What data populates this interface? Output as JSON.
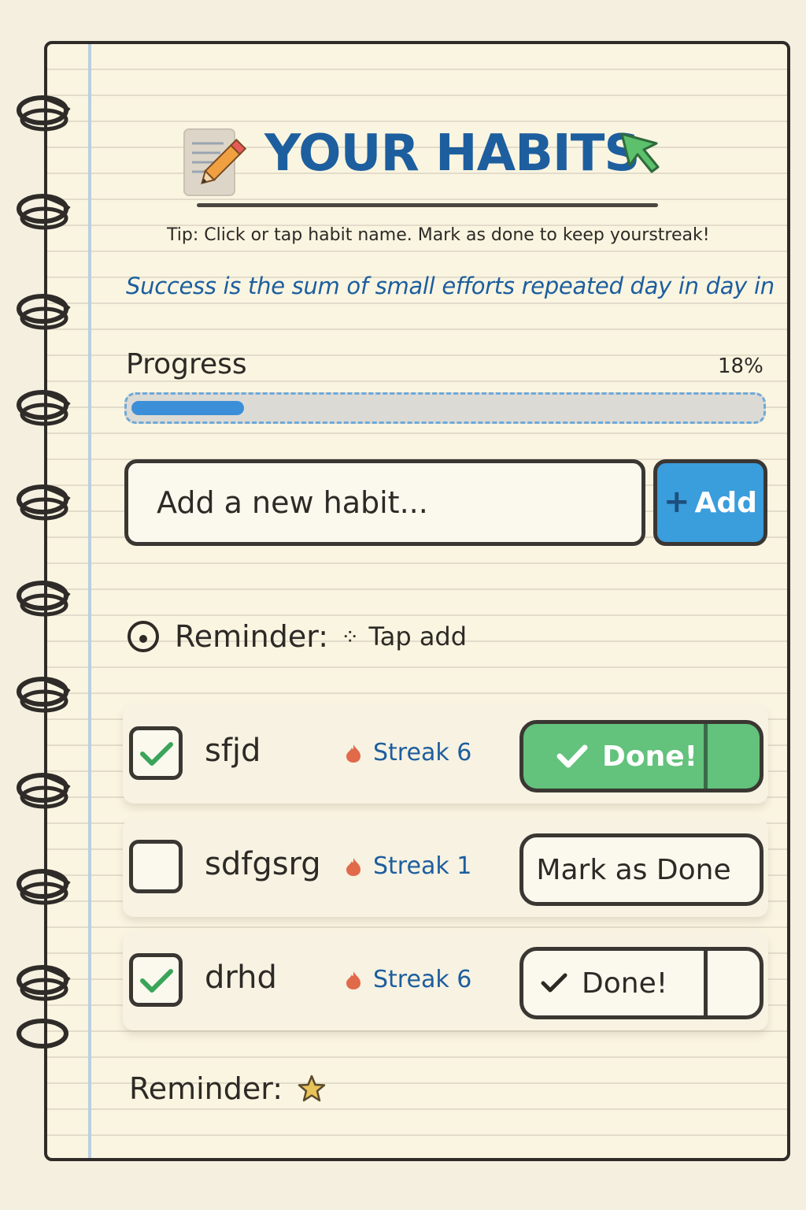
{
  "header": {
    "title": "YOUR HABITS",
    "tip": "Tip: Click or tap habit name. Mark as done to keep yourstreak!",
    "quote": "Success is the sum of small efforts repeated day in day in"
  },
  "progress": {
    "label": "Progress",
    "percent_text": "18%",
    "value": 0.18
  },
  "new_habit": {
    "placeholder": "Add a new habit...",
    "add_label": "Add"
  },
  "reminder_top": {
    "label": "Reminder:",
    "value": "Tap add"
  },
  "habits": [
    {
      "name": "sfjd",
      "streak": "Streak 6",
      "checked": true,
      "action": "Done!",
      "action_style": "green"
    },
    {
      "name": "sdfgsrg",
      "streak": "Streak 1",
      "checked": false,
      "action": "Mark as Done",
      "action_style": "plain"
    },
    {
      "name": "drhd",
      "streak": "Streak 6",
      "checked": true,
      "action": "Done!",
      "action_style": "outline"
    }
  ],
  "reminder_bottom": {
    "label": "Reminder:"
  },
  "colors": {
    "accent_blue": "#1d5e9e",
    "progress_blue": "#3a8fd8",
    "add_button": "#3a9ddc",
    "done_green": "#63c27c",
    "check_green": "#3aa55a",
    "streak_icon": "#e06a4a",
    "paper": "#faf5e1"
  }
}
